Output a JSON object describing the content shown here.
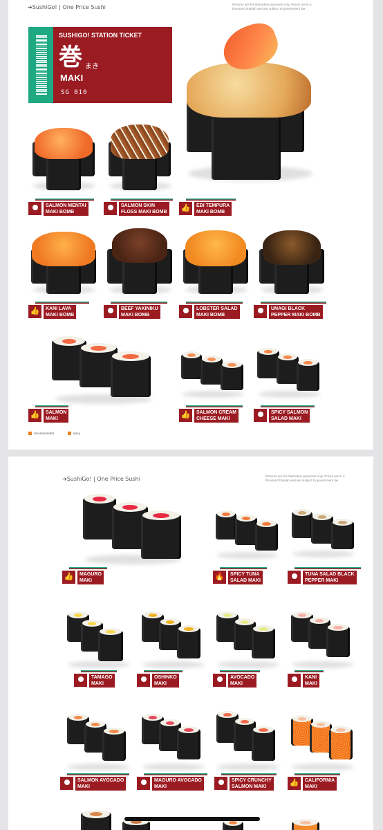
{
  "page1": {
    "brand": "➔SushiGo! | One Price Sushi",
    "disclaimer": "Pictures are for illustration purposes only. Prices are in a thousand Rupiah and are subject to government tax.",
    "ticket": {
      "title": "SUSHIGO! STATION TICKET",
      "kanji": "巻",
      "kana": "まき",
      "subtitle": "MAKI",
      "code": "SG 010"
    },
    "items": [
      {
        "line1": "SALMON MENTAI",
        "line2": "MAKI BOMB",
        "icon": "dot-icon"
      },
      {
        "line1": "SALMON SKIN",
        "line2": "FLOSS MAKI BOMB",
        "icon": "dot-icon"
      },
      {
        "line1": "EBI TEMPURA",
        "line2": "MAKI BOMB",
        "icon": "thumbs-up-icon"
      },
      {
        "line1": "KANI LAVA",
        "line2": "MAKI BOMB",
        "icon": "thumbs-up-icon"
      },
      {
        "line1": "BEEF YAKINIKU",
        "line2": "MAKI BOMB",
        "icon": "dot-icon"
      },
      {
        "line1": "LOBSTER SALAD",
        "line2": "MAKI BOMB",
        "icon": "dot-icon"
      },
      {
        "line1": "UNAGI BLACK",
        "line2": "PEPPER MAKI BOMB",
        "icon": "dot-icon"
      },
      {
        "line1": "SALMON",
        "line2": "MAKI",
        "icon": "thumbs-up-icon"
      },
      {
        "line1": "SALMON CREAM",
        "line2": "CHEESE MAKI",
        "icon": "thumbs-up-icon"
      },
      {
        "line1": "SPICY SALMON",
        "line2": "SALAD MAKI",
        "icon": "dot-icon"
      }
    ],
    "legend": {
      "recommended": "recommended",
      "spicy": "spicy"
    }
  },
  "page2": {
    "brand": "➔SushiGo! | One Price Sushi",
    "disclaimer": "Pictures are for illustration purposes only. Prices are in a thousand Rupiah and are subject to government tax.",
    "items": [
      {
        "line1": "MAGURO",
        "line2": "MAKI",
        "icon": "thumbs-up-icon"
      },
      {
        "line1": "SPICY TUNA",
        "line2": "SALAD MAKI",
        "icon": "flame-icon"
      },
      {
        "line1": "TUNA SALAD BLACK",
        "line2": "PEPPER MAKI",
        "icon": "dot-icon"
      },
      {
        "line1": "TAMAGO",
        "line2": "MAKI",
        "icon": "dot-icon"
      },
      {
        "line1": "OSHINKO",
        "line2": "MAKI",
        "icon": "dot-icon"
      },
      {
        "line1": "AVOCADO",
        "line2": "MAKI",
        "icon": "dot-icon"
      },
      {
        "line1": "KANI",
        "line2": "MAKI",
        "icon": "dot-icon"
      },
      {
        "line1": "SALMON AVOCADO",
        "line2": "MAKI",
        "icon": "dot-icon"
      },
      {
        "line1": "MAGURO AVOCADO",
        "line2": "MAKI",
        "icon": "dot-icon"
      },
      {
        "line1": "SPICY CRUNCHY",
        "line2": "SALMON MAKI",
        "icon": "dot-icon"
      },
      {
        "line1": "CALIFORNIA",
        "line2": "MAKI",
        "icon": "thumbs-up-icon"
      }
    ]
  },
  "colors": {
    "accent_red": "#9b1b22",
    "accent_green": "#1ea983"
  }
}
